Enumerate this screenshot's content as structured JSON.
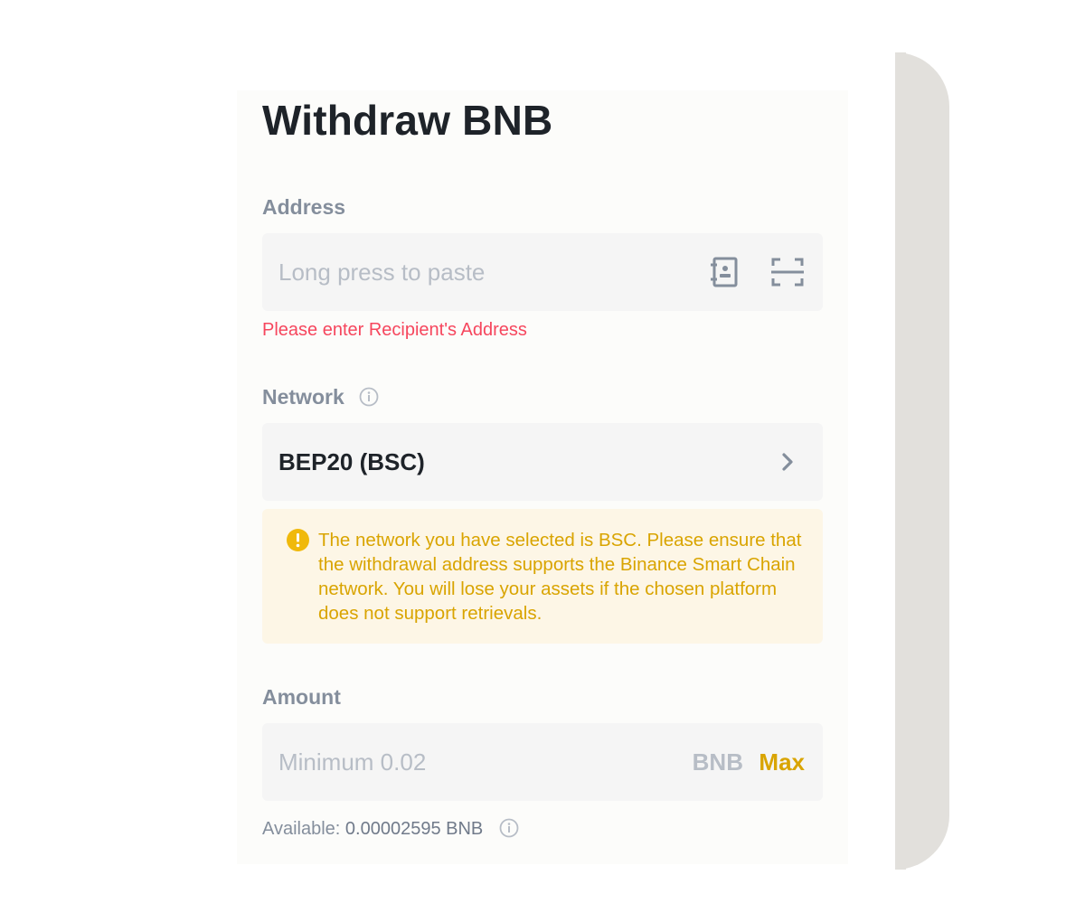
{
  "title": "Withdraw BNB",
  "address": {
    "label": "Address",
    "placeholder": "Long press to paste",
    "address_book_icon": "address-book-icon",
    "scan_icon": "scan-icon",
    "error": "Please enter Recipient's Address"
  },
  "network": {
    "label": "Network",
    "info_icon": "info-icon",
    "selected": "BEP20 (BSC)",
    "chevron_icon": "chevron-right-icon",
    "warning": "The network you have selected is BSC. Please ensure that the withdrawal address supports the Binance Smart Chain network. You will lose your assets if the chosen platform does not support retrievals."
  },
  "amount": {
    "label": "Amount",
    "placeholder": "Minimum 0.02",
    "unit": "BNB",
    "max_label": "Max",
    "available_label": "Available:",
    "available_value": "0.00002595 BNB"
  },
  "colors": {
    "accent": "#d9a400",
    "error": "#f6465d",
    "text_primary": "#1e2329",
    "text_secondary": "#848e9c"
  }
}
